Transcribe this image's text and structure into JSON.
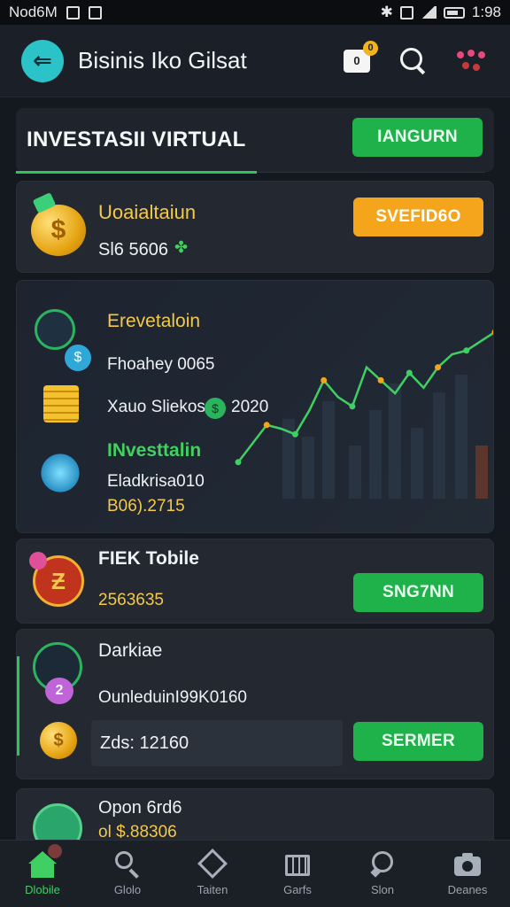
{
  "status_bar": {
    "left_text": "Nod6M",
    "right_text": "1:98"
  },
  "app": {
    "title": "Bisinis Iko Gilsat",
    "cart_badge": "0",
    "cart_letter": "0"
  },
  "section": {
    "title": "INVESTASII VIRTUAL",
    "button": "IANGURN"
  },
  "wallet": {
    "title": "Uoaialtaiun",
    "amount": "Sl6 5606",
    "button": "SVEFID6O"
  },
  "investment_card": {
    "heading": "Erevetaloin",
    "line1": "Fhoahey 0065",
    "line2_label": "Xauo Sliekos",
    "line2_value": "2020",
    "subheading": "INvesttalin",
    "line3": "Eladkrisa010",
    "line4": "B06).2715",
    "chart_points": [
      12,
      22,
      32,
      30,
      27,
      40,
      56,
      47,
      42,
      63,
      56,
      49,
      60,
      52,
      63,
      70,
      72,
      77,
      82
    ]
  },
  "fiet_card": {
    "title": "FIEK Tobile",
    "value": "2563635",
    "button": "SNG7NN"
  },
  "dark_card": {
    "title": "Darkiae",
    "subtitle": "OunleduinI99K0160",
    "total_label": "Zds: 12160",
    "button": "SERMER"
  },
  "partial_card": {
    "title": "Opon 6rd6",
    "value": "ol $.88306"
  },
  "bottom_nav": [
    {
      "label": "Dlobile",
      "icon": "home-icon",
      "active": true
    },
    {
      "label": "Glolo",
      "icon": "search-icon",
      "active": false
    },
    {
      "label": "Taiten",
      "icon": "badge-icon",
      "active": false
    },
    {
      "label": "Garfs",
      "icon": "store-icon",
      "active": false
    },
    {
      "label": "Slon",
      "icon": "chat-icon",
      "active": false
    },
    {
      "label": "Deanes",
      "icon": "camera-icon",
      "active": false
    }
  ],
  "colors": {
    "accent_green": "#20b24a",
    "accent_orange": "#f4a51c",
    "gold_text": "#f4c94a",
    "background": "#14181f"
  }
}
